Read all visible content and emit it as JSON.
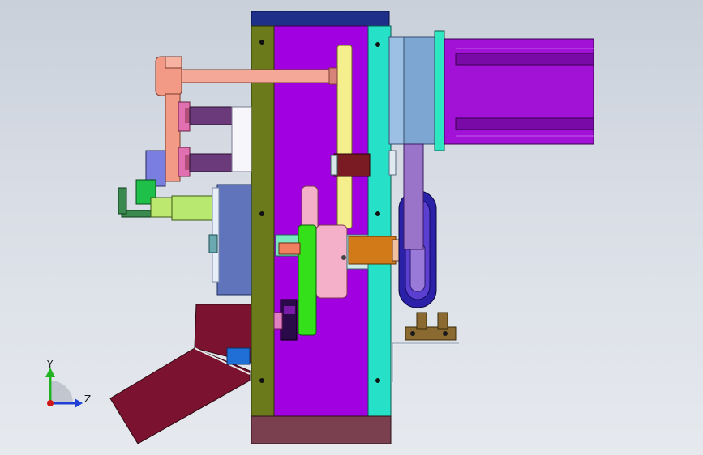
{
  "viewport": {
    "background_top": "#c9d0da",
    "background_bottom": "#e6e9ee"
  },
  "triad": {
    "y_label": "Y",
    "z_label": "Z",
    "y_axis_color": "#22b322",
    "z_axis_color": "#1f3fd6",
    "origin_color": "#d01616"
  },
  "model_colors": {
    "frame_top": "#1e2f8a",
    "frame_left": "#6b7a1b",
    "frame_center": "#a100e0",
    "frame_right": "#26e0c8",
    "frame_bottom": "#7a4050",
    "motor": "#a112d6",
    "motor_flange": "#7ea6d2",
    "motor_ring": "#2ee6c0",
    "belt": "#f4ef8c",
    "gear_green": "#33e01a",
    "chute": "#7a1230",
    "bracket_pink": "#f29a86",
    "pulley": "#2b20a8",
    "block_blue": "#5f74ba"
  }
}
